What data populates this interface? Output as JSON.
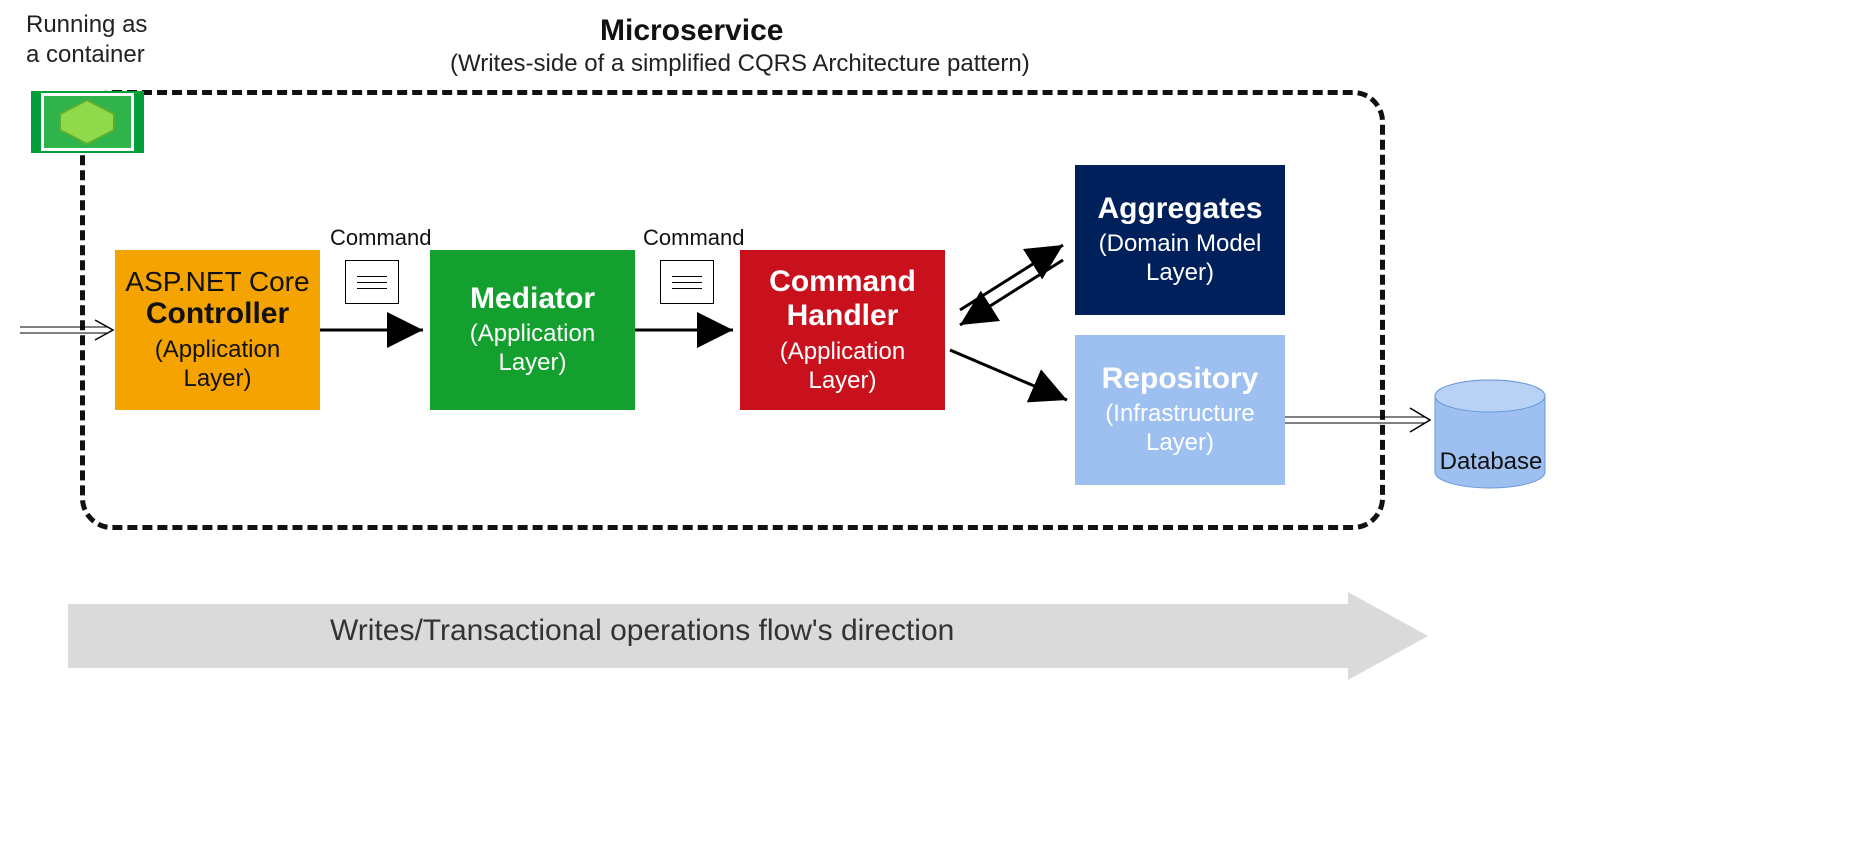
{
  "container_label_line1": "Running as",
  "container_label_line2": "a container",
  "microservice": {
    "title": "Microservice",
    "subtitle": "(Writes-side of a simplified CQRS Architecture pattern)"
  },
  "boxes": {
    "controller": {
      "line1": "ASP.NET Core",
      "title": "Controller",
      "sub": "(Application Layer)"
    },
    "mediator": {
      "title": "Mediator",
      "sub": "(Application Layer)"
    },
    "handler": {
      "title": "Command Handler",
      "sub": "(Application Layer)"
    },
    "aggregates": {
      "title": "Aggregates",
      "sub": "(Domain Model Layer)"
    },
    "repository": {
      "title": "Repository",
      "sub": "(Infrastructure Layer)"
    }
  },
  "command_label": "Command",
  "database_label": "Database",
  "flow_label": "Writes/Transactional operations flow's direction",
  "colors": {
    "controller": "#F5A300",
    "mediator": "#14A02F",
    "handler": "#C9111E",
    "aggregates": "#00205B",
    "repository": "#9DC0F0",
    "database": "#9DC0F0",
    "flow_bar": "#DADADA"
  }
}
